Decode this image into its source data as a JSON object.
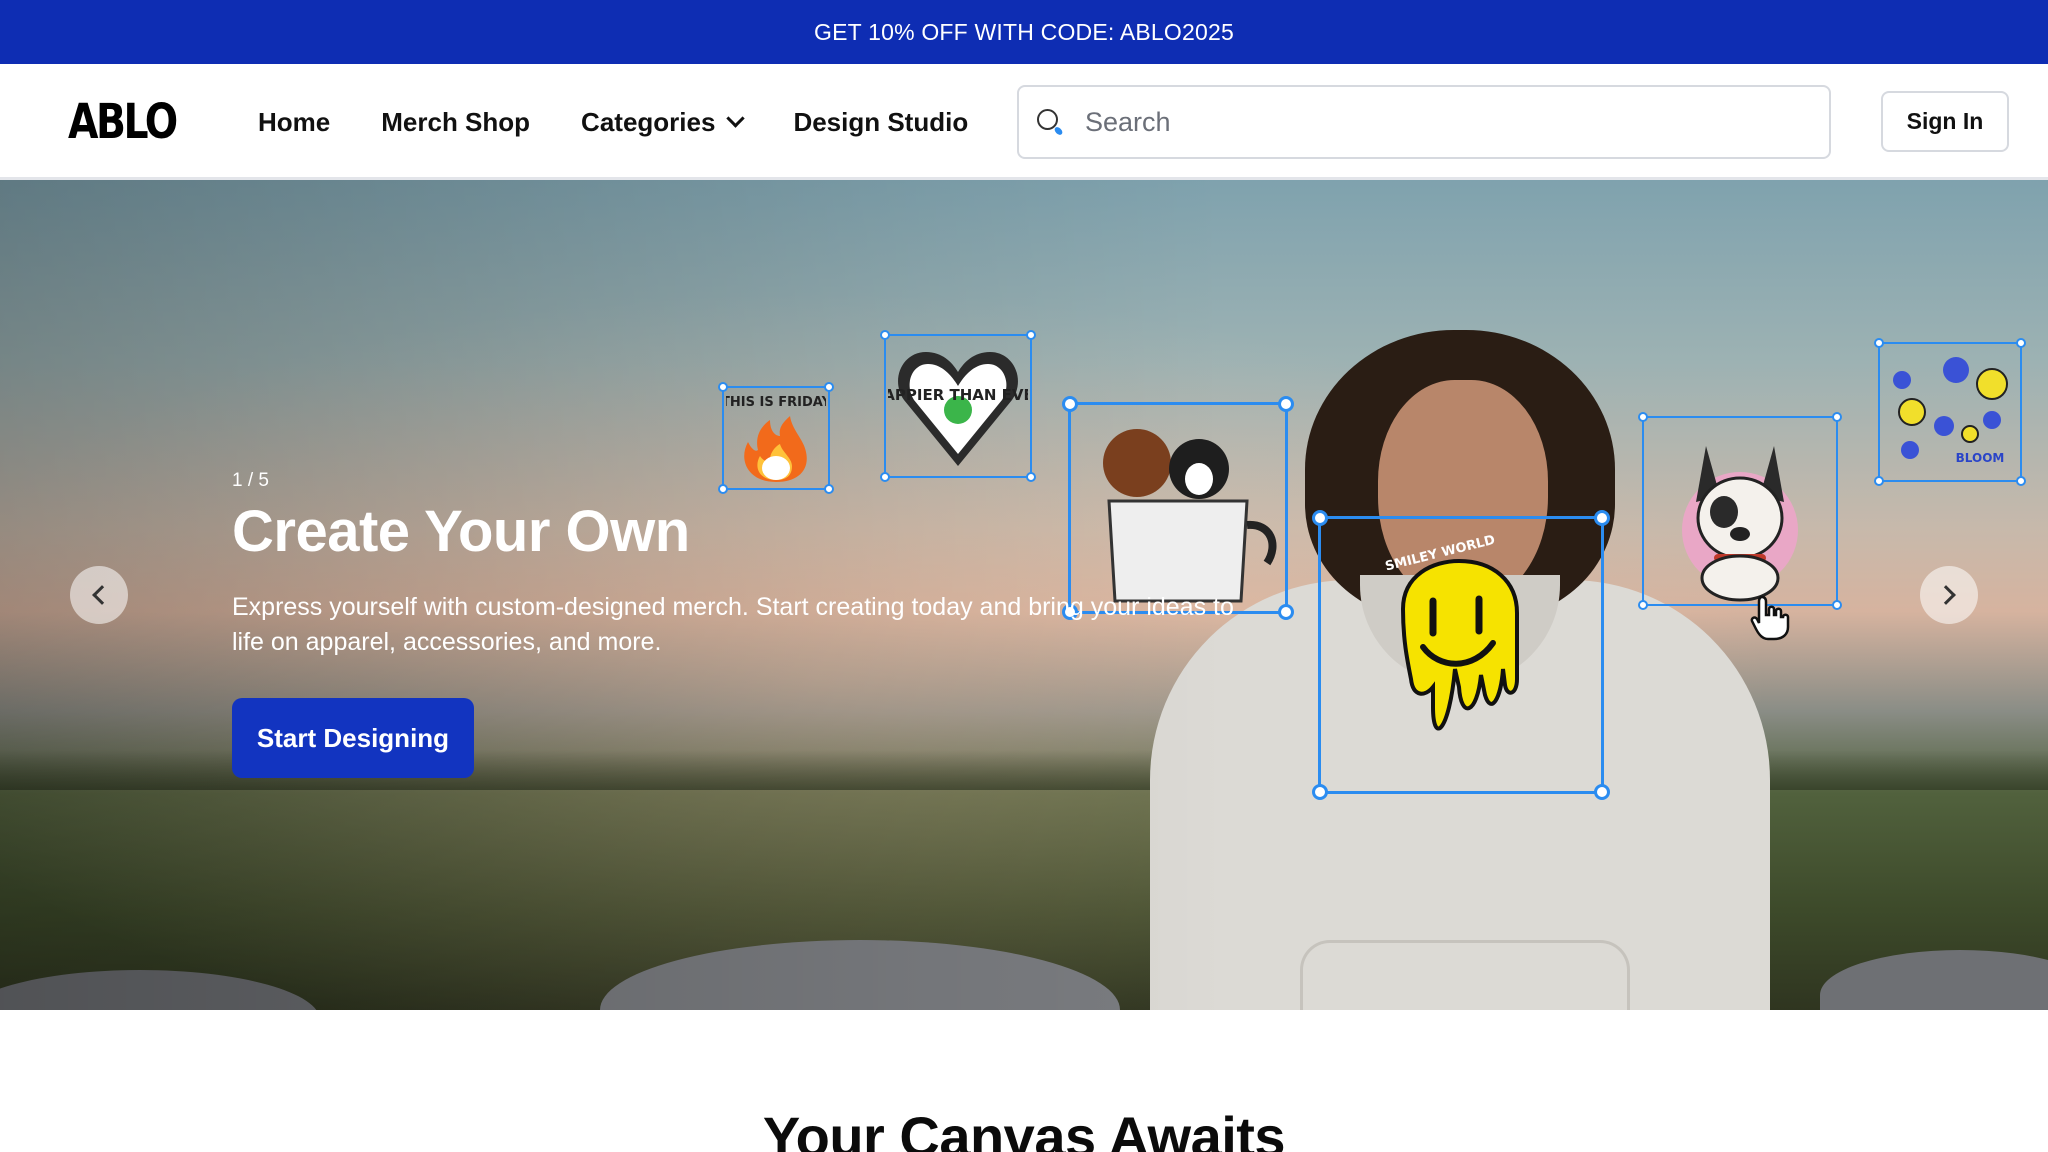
{
  "promo": {
    "text": "GET 10% OFF WITH CODE: ABLO2025"
  },
  "header": {
    "logo": "ABLO",
    "nav": [
      "Home",
      "Merch Shop",
      "Categories",
      "Design Studio"
    ],
    "search_placeholder": "Search",
    "signin": "Sign In"
  },
  "hero": {
    "counter": "1 / 5",
    "title": "Create Your Own",
    "subtitle": "Express yourself with custom-designed merch. Start creating today and bring your ideas to life on apparel, accessories, and more.",
    "cta": "Start Designing",
    "stickers": {
      "friday": "THIS IS FRIDAY",
      "happier": "HAPPIER THAN EVER",
      "smiley": "SMILEY WORLD",
      "bloom": "BLOOM"
    }
  },
  "section": {
    "title": "Your Canvas Awaits"
  },
  "colors": {
    "brand": "#0e2db3",
    "selection": "#2b8cf0"
  }
}
